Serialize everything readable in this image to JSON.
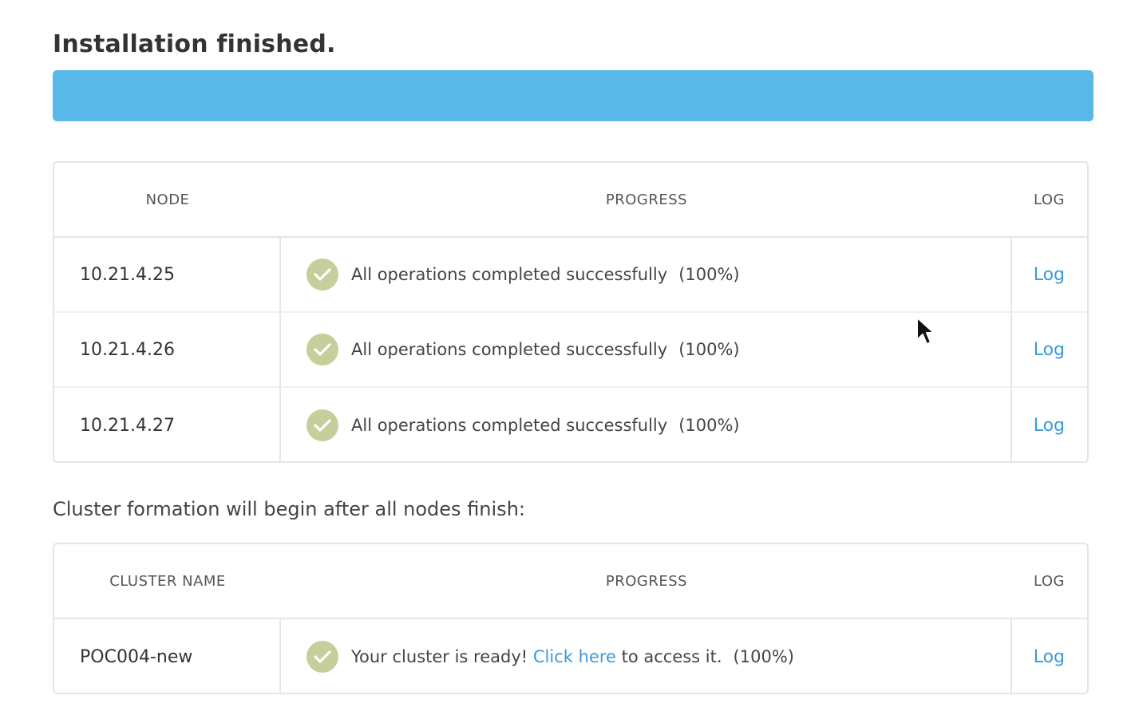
{
  "title": "Installation finished.",
  "overall_progress_percent": 100,
  "colors": {
    "progress_bar": "#58b9e8",
    "check_badge": "#c4cf9b",
    "link": "#3a9ad9"
  },
  "nodes_table": {
    "headers": {
      "node": "NODE",
      "progress": "PROGRESS",
      "log": "LOG"
    },
    "rows": [
      {
        "node": "10.21.4.25",
        "status": "All operations completed successfully",
        "percent": "(100%)",
        "log": "Log"
      },
      {
        "node": "10.21.4.26",
        "status": "All operations completed successfully",
        "percent": "(100%)",
        "log": "Log"
      },
      {
        "node": "10.21.4.27",
        "status": "All operations completed successfully",
        "percent": "(100%)",
        "log": "Log"
      }
    ]
  },
  "cluster_subtitle": "Cluster formation will begin after all nodes finish:",
  "cluster_table": {
    "headers": {
      "name": "CLUSTER NAME",
      "progress": "PROGRESS",
      "log": "LOG"
    },
    "rows": [
      {
        "name": "POC004-new",
        "status_prefix": "Your cluster is ready! ",
        "status_link": "Click here",
        "status_suffix": " to access it.",
        "percent": "(100%)",
        "log": "Log"
      }
    ]
  }
}
